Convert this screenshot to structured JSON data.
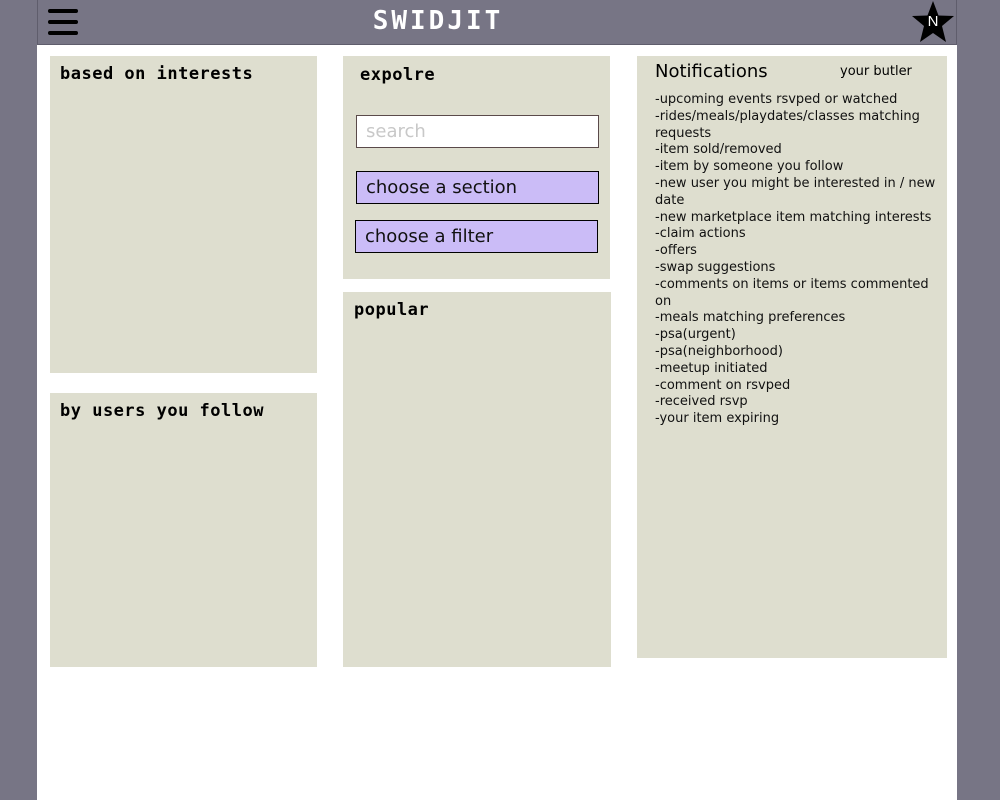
{
  "header": {
    "brand": "SWIDJIT",
    "badge_letter": "N"
  },
  "interests_panel": {
    "title": "based on interests"
  },
  "following_panel": {
    "title": "by users you follow"
  },
  "explore_panel": {
    "title": "expolre",
    "search_placeholder": "search",
    "section_button": "choose a section",
    "filter_button": "choose a filter"
  },
  "popular_panel": {
    "title": "popular"
  },
  "notifications": {
    "title": "Notifications",
    "butler": "your butler",
    "items": [
      "-upcoming events rsvped or watched",
      "-rides/meals/playdates/classes matching requests",
      "-item sold/removed",
      "-item by someone you follow",
      "-new user you might be interested in / new date",
      "-new marketplace item matching interests",
      "-claim actions",
      "-offers",
      "-swap suggestions",
      "-comments on items or items commented on",
      "-meals matching preferences",
      "-psa(urgent)",
      "-psa(neighborhood)",
      "-meetup initiated",
      "-comment on rsvped",
      "-received rsvp",
      "-your item expiring"
    ]
  },
  "colors": {
    "frame": "#777585",
    "panel": "#dedecf",
    "button": "#cbbcf7"
  }
}
